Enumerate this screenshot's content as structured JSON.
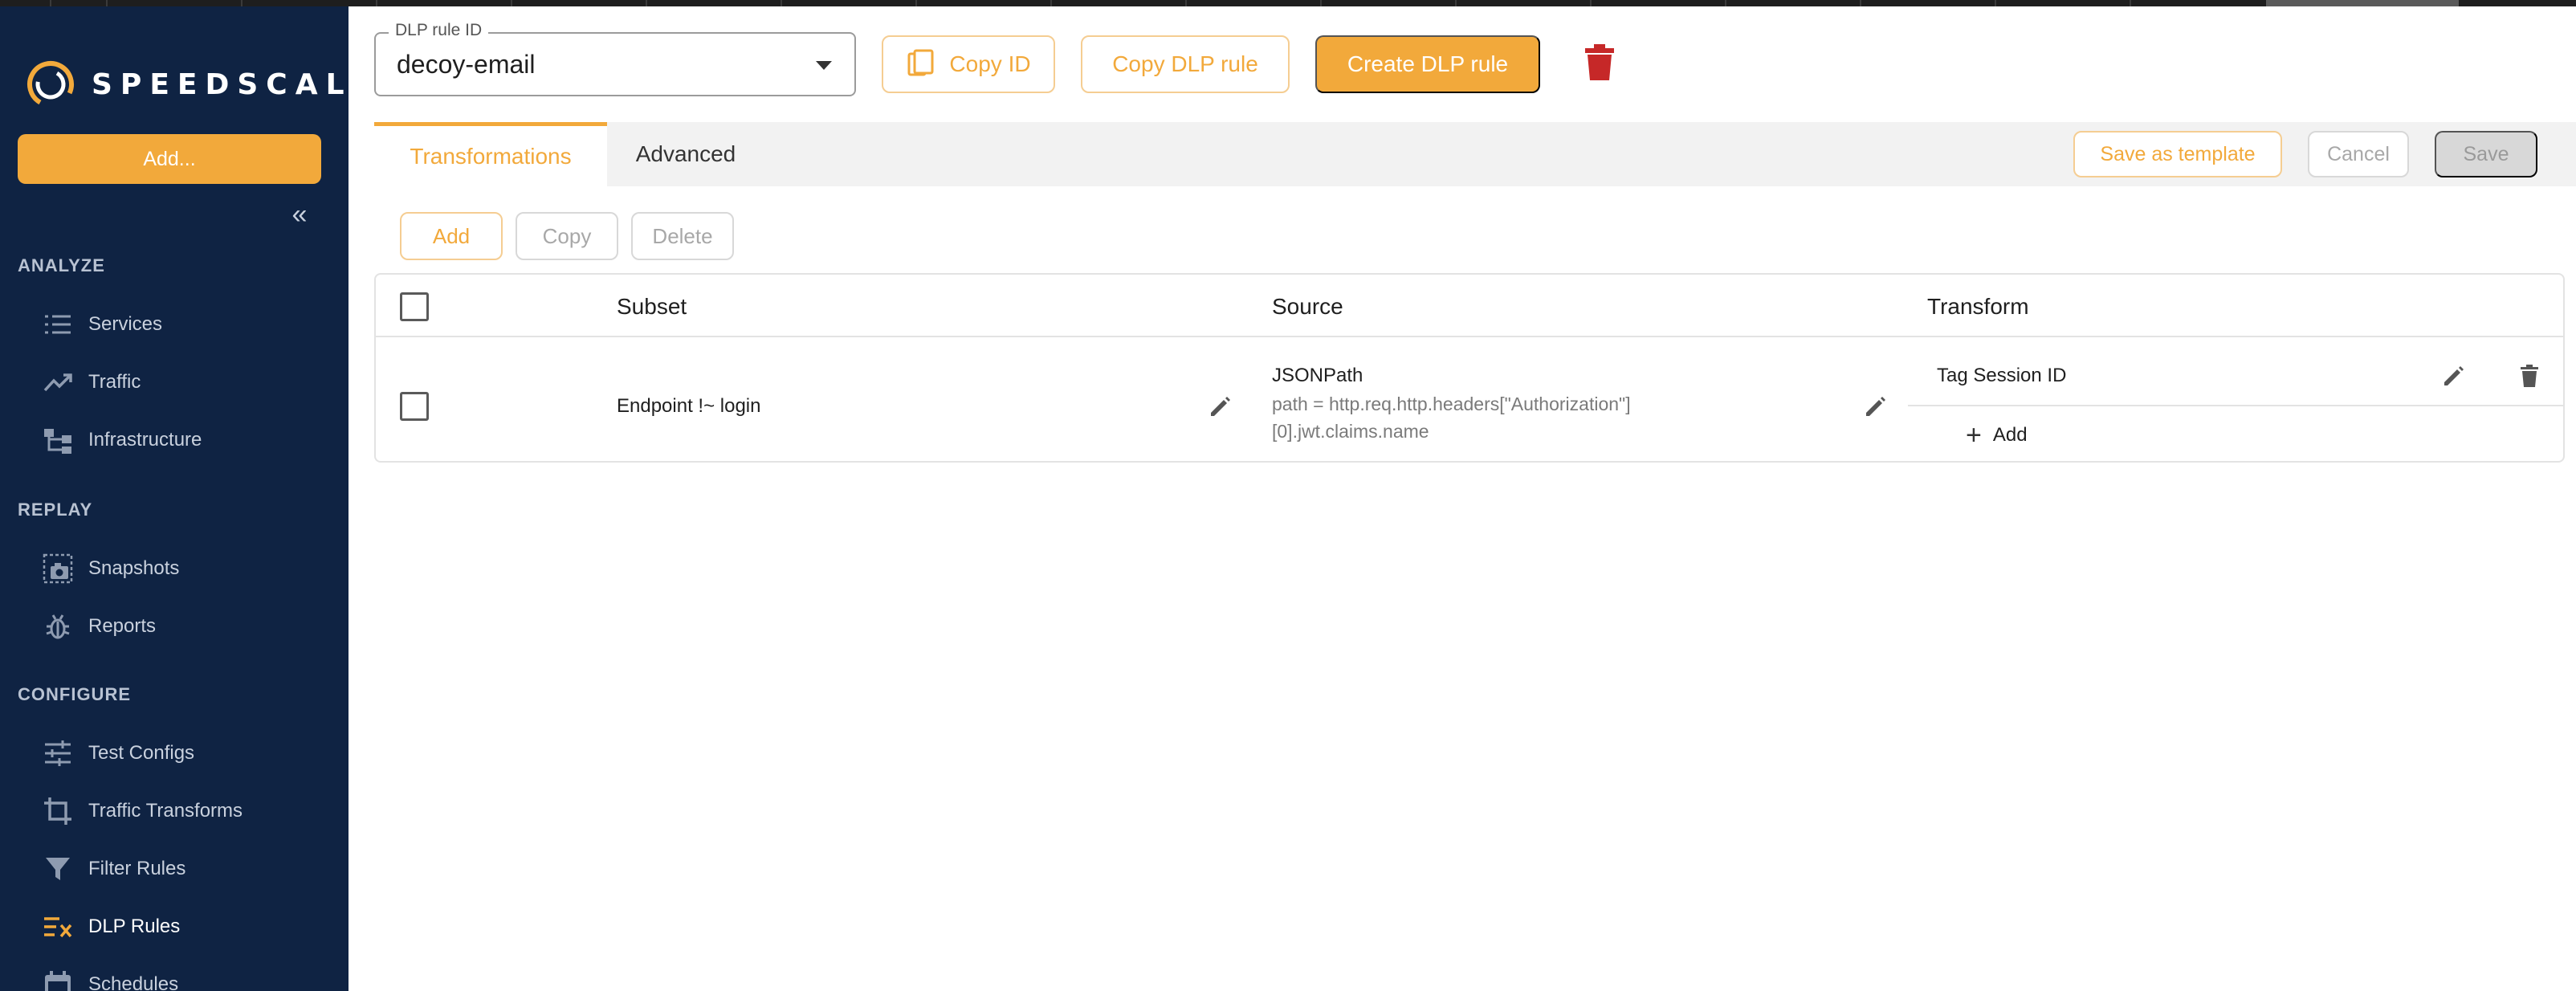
{
  "sidebar": {
    "brand": "SPEEDSCALE",
    "add_button": "Add...",
    "collapse_icon": "double-chevron-left-icon",
    "sections": [
      {
        "label": "ANALYZE",
        "items": [
          {
            "label": "Services",
            "icon": "list-icon"
          },
          {
            "label": "Traffic",
            "icon": "trending-up-icon"
          },
          {
            "label": "Infrastructure",
            "icon": "hierarchy-icon"
          }
        ]
      },
      {
        "label": "REPLAY",
        "items": [
          {
            "label": "Snapshots",
            "icon": "camera-icon"
          },
          {
            "label": "Reports",
            "icon": "bug-icon"
          }
        ]
      },
      {
        "label": "CONFIGURE",
        "items": [
          {
            "label": "Test Configs",
            "icon": "sliders-icon"
          },
          {
            "label": "Traffic Transforms",
            "icon": "crop-icon"
          },
          {
            "label": "Filter Rules",
            "icon": "filter-icon"
          },
          {
            "label": "DLP Rules",
            "icon": "redact-list-icon",
            "active": true
          },
          {
            "label": "Schedules",
            "icon": "calendar-icon"
          }
        ]
      }
    ]
  },
  "header": {
    "rule_id_label": "DLP rule ID",
    "rule_id_value": "decoy-email",
    "copy_id": "Copy ID",
    "copy_rule": "Copy DLP rule",
    "create_rule": "Create DLP rule"
  },
  "tabs": {
    "items": [
      {
        "label": "Transformations",
        "active": true
      },
      {
        "label": "Advanced",
        "active": false
      }
    ],
    "save_template": "Save as template",
    "cancel": "Cancel",
    "save": "Save"
  },
  "toolbar": {
    "add": "Add",
    "copy": "Copy",
    "delete": "Delete"
  },
  "table": {
    "columns": [
      "Subset",
      "Source",
      "Transform"
    ],
    "rows": [
      {
        "subset": "Endpoint !~ login",
        "source_type": "JSONPath",
        "source_path_line1": "path = http.req.http.headers[\"Authorization\"]",
        "source_path_line2": "[0].jwt.claims.name",
        "transform": "Tag Session ID",
        "add_transform": "Add"
      }
    ]
  },
  "colors": {
    "sidebar_bg": "#0f2343",
    "accent": "#f2a93b",
    "danger": "#c62828"
  }
}
